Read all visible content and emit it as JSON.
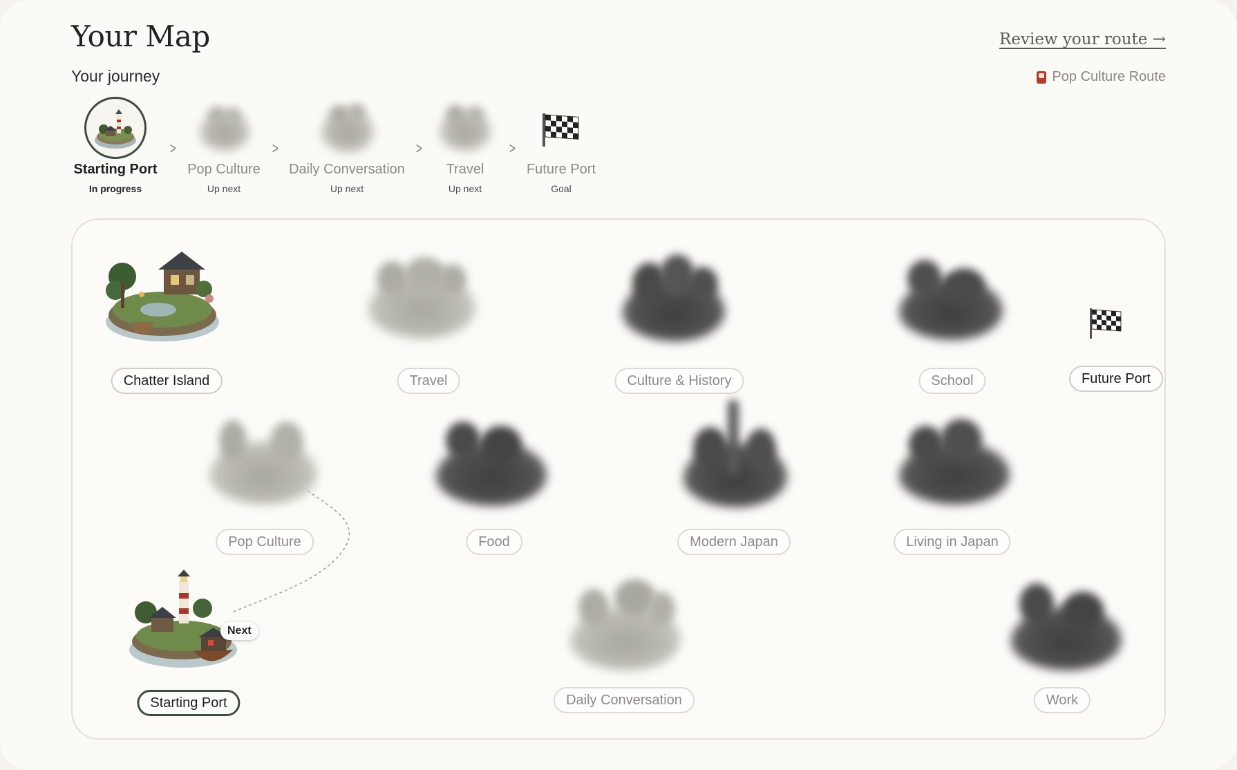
{
  "header": {
    "title": "Your Map",
    "review_link": "Review your route →",
    "journey_heading": "Your journey",
    "route_name": "Pop Culture Route"
  },
  "journey": [
    {
      "name": "Starting Port",
      "status": "In progress",
      "state": "current"
    },
    {
      "name": "Pop Culture",
      "status": "Up next",
      "state": "locked"
    },
    {
      "name": "Daily Conversation",
      "status": "Up next",
      "state": "locked"
    },
    {
      "name": "Travel",
      "status": "Up next",
      "state": "locked"
    },
    {
      "name": "Future Port",
      "status": "Goal",
      "state": "goal"
    }
  ],
  "map": {
    "next_badge": "Next",
    "nodes": [
      {
        "label": "Chatter Island",
        "state": "unlocked"
      },
      {
        "label": "Travel",
        "state": "locked-light"
      },
      {
        "label": "Culture & History",
        "state": "locked-dark"
      },
      {
        "label": "School",
        "state": "locked-dark"
      },
      {
        "label": "Future Port",
        "state": "goal"
      },
      {
        "label": "Pop Culture",
        "state": "locked-light"
      },
      {
        "label": "Food",
        "state": "locked-dark"
      },
      {
        "label": "Modern Japan",
        "state": "locked-dark"
      },
      {
        "label": "Living in Japan",
        "state": "locked-dark"
      },
      {
        "label": "Starting Port",
        "state": "current"
      },
      {
        "label": "Daily Conversation",
        "state": "locked-light"
      },
      {
        "label": "Work",
        "state": "locked-dark"
      }
    ]
  },
  "colors": {
    "accent": "#3f4d3e",
    "background": "#fafaf7",
    "muted_text": "#8b8a85"
  }
}
